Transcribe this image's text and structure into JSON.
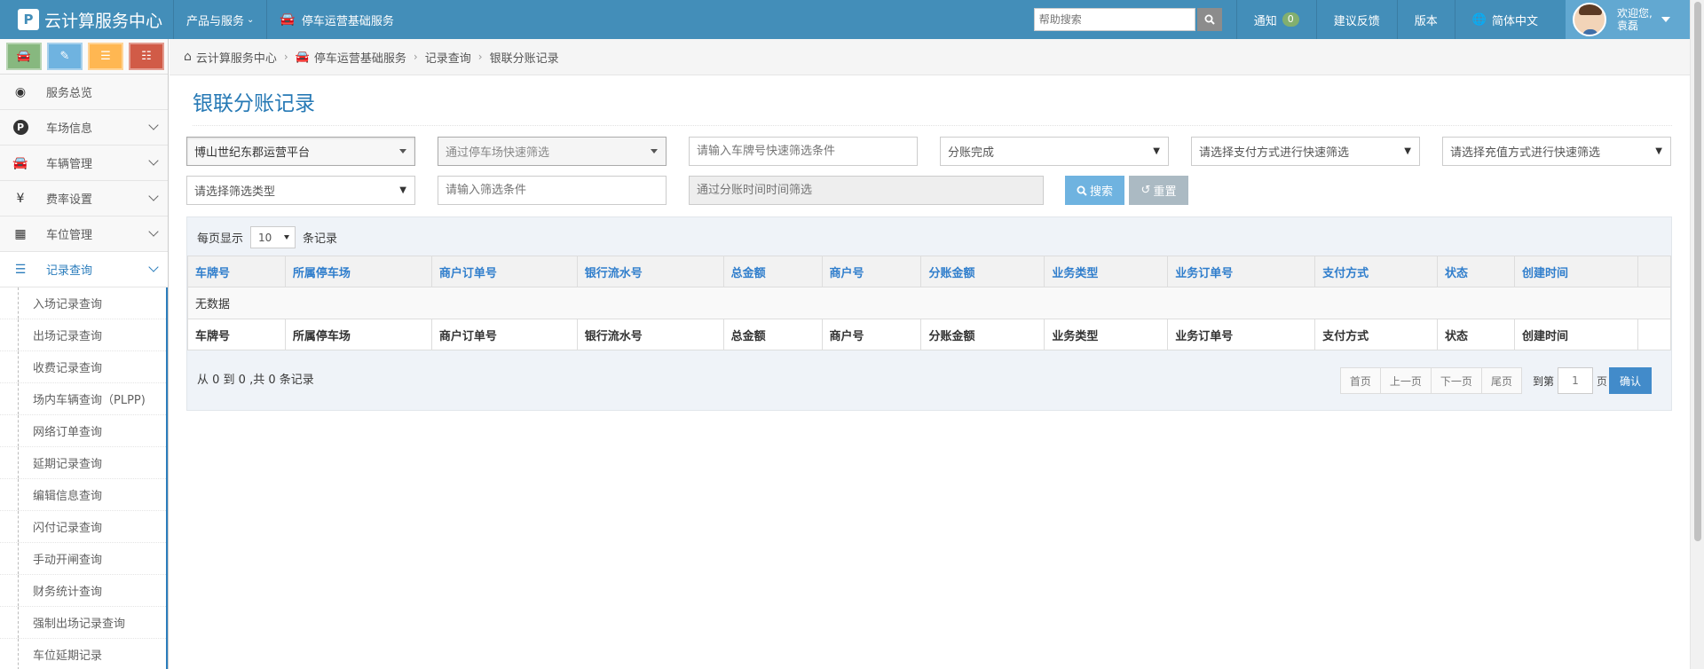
{
  "header": {
    "brand_logo": "P",
    "brand_title": "云计算服务中心",
    "nav": [
      {
        "label": "产品与服务",
        "icon": "chevron-down-icon"
      },
      {
        "label": "停车运营基础服务",
        "icon": "car-icon"
      }
    ],
    "search_placeholder": "帮助搜索",
    "notify_label": "通知",
    "notify_count": "0",
    "feedback_label": "建议反馈",
    "version_label": "版本",
    "language_label": "简体中文",
    "user_greeting": "欢迎您,",
    "user_name": "袁磊"
  },
  "sidebar": {
    "menu": [
      {
        "label": "服务总览",
        "icon": "dashboard-icon"
      },
      {
        "label": "车场信息",
        "icon": "parking-icon"
      },
      {
        "label": "车辆管理",
        "icon": "car-icon"
      },
      {
        "label": "费率设置",
        "icon": "yen-icon"
      },
      {
        "label": "车位管理",
        "icon": "grid-icon"
      },
      {
        "label": "记录查询",
        "icon": "list-icon"
      }
    ],
    "submenu": [
      "入场记录查询",
      "出场记录查询",
      "收费记录查询",
      "场内车辆查询（PLPP)",
      "网络订单查询",
      "延期记录查询",
      "编辑信息查询",
      "闪付记录查询",
      "手动开闸查询",
      "财务统计查询",
      "强制出场记录查询",
      "车位延期记录"
    ]
  },
  "breadcrumb": {
    "items": [
      "云计算服务中心",
      "停车运营基础服务",
      "记录查询",
      "银联分账记录"
    ]
  },
  "page": {
    "title": "银联分账记录"
  },
  "filters": {
    "platform": "博山世纪东郡运营平台",
    "parking_select": "通过停车场快速筛选",
    "plate_placeholder": "请输入车牌号快速筛选条件",
    "status": "分账完成",
    "pay_method": "请选择支付方式进行快速筛选",
    "recharge_method": "请选择充值方式进行快速筛选",
    "filter_type": "请选择筛选类型",
    "filter_value_placeholder": "请输入筛选条件",
    "time_placeholder": "通过分账时间时间筛选",
    "search_label": "搜索",
    "reset_label": "重置"
  },
  "table": {
    "per_page_prefix": "每页显示",
    "per_page_value": "10",
    "per_page_suffix": "条记录",
    "columns": [
      "车牌号",
      "所属停车场",
      "商户订单号",
      "银行流水号",
      "总金额",
      "商户号",
      "分账金额",
      "业务类型",
      "业务订单号",
      "支付方式",
      "状态",
      "创建时间"
    ],
    "empty_text": "无数据",
    "info": "从 0 到 0 ,共 0 条记录",
    "pager": {
      "first": "首页",
      "prev": "上一页",
      "next": "下一页",
      "last": "尾页",
      "goto_prefix": "到第",
      "goto_value": "1",
      "goto_suffix": "页",
      "confirm": "确认"
    }
  },
  "colors": {
    "navbar": "#438eb9",
    "accent": "#2679b5",
    "search_button": "#6fb3e0",
    "reset_button": "#abbac3",
    "confirm_button": "#428bca"
  }
}
